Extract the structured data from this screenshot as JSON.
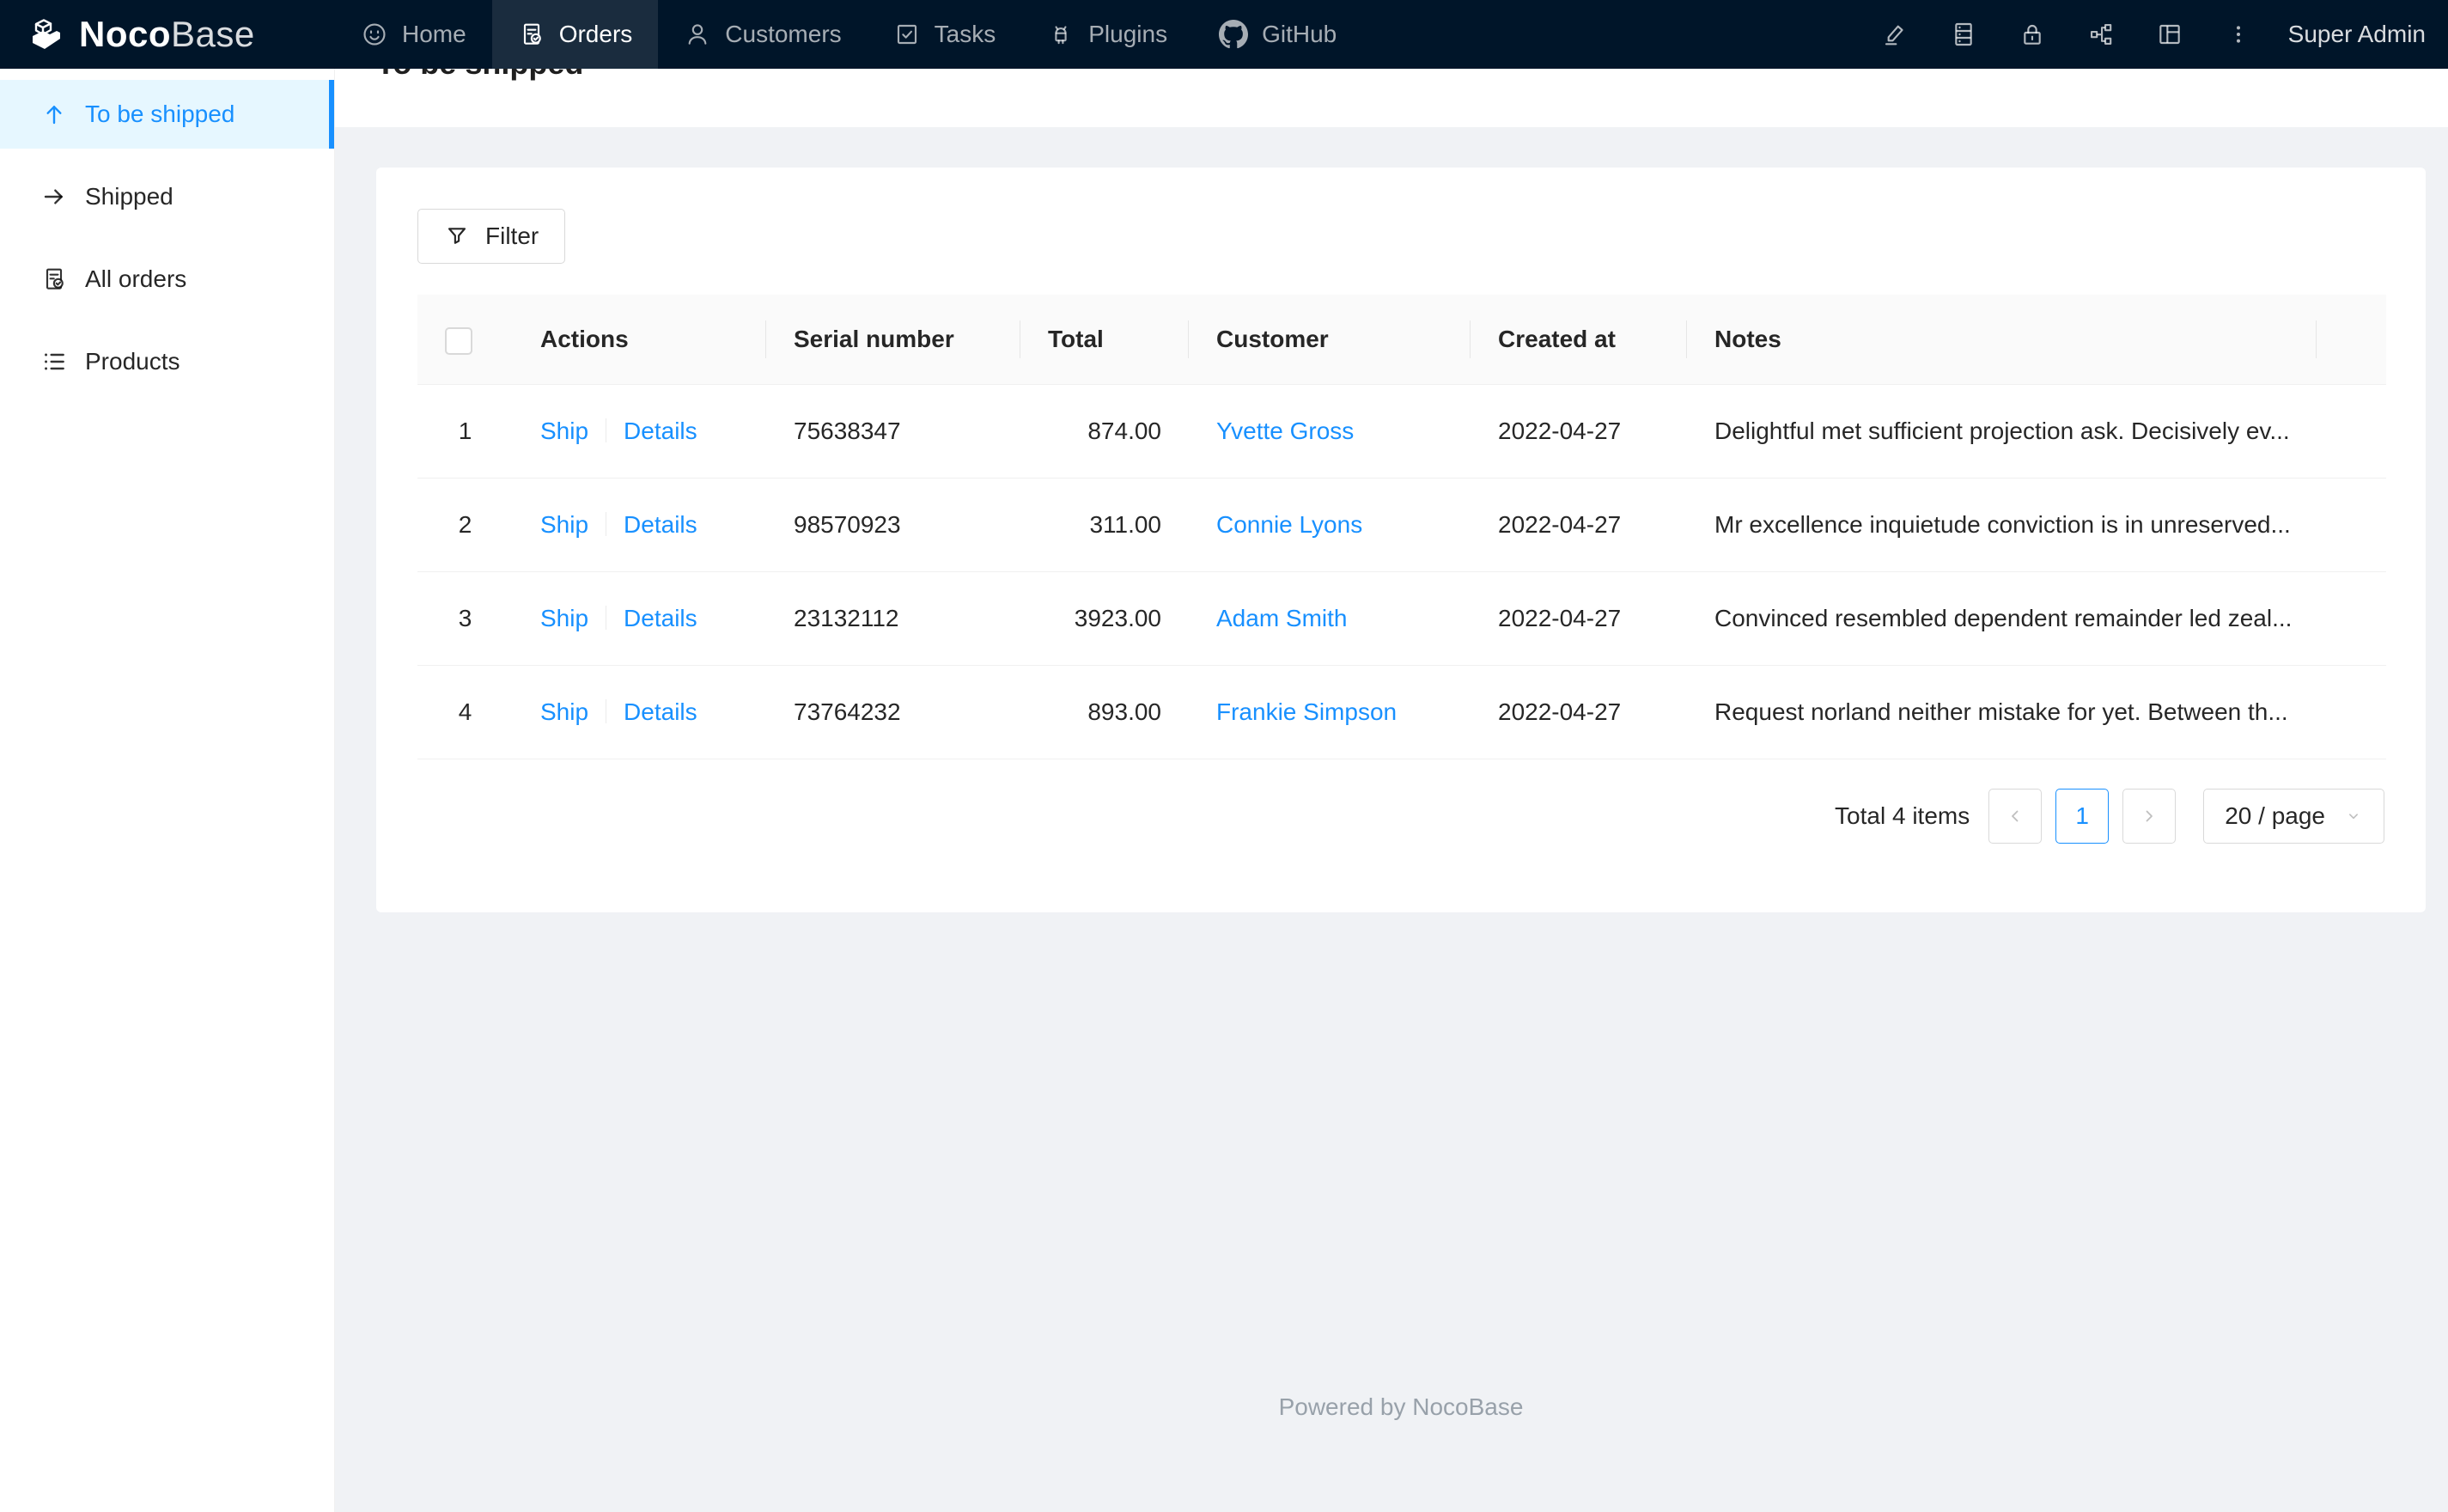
{
  "app": {
    "brand_bold": "Noco",
    "brand_light": "Base",
    "user": "Super Admin"
  },
  "nav": {
    "items": [
      {
        "label": "Home"
      },
      {
        "label": "Orders"
      },
      {
        "label": "Customers"
      },
      {
        "label": "Tasks"
      },
      {
        "label": "Plugins"
      },
      {
        "label": "GitHub"
      }
    ]
  },
  "sidebar": {
    "items": [
      {
        "label": "To be shipped"
      },
      {
        "label": "Shipped"
      },
      {
        "label": "All orders"
      },
      {
        "label": "Products"
      }
    ]
  },
  "page": {
    "title": "To be shipped"
  },
  "toolbar": {
    "filter_label": "Filter"
  },
  "table": {
    "columns": {
      "actions": "Actions",
      "serial": "Serial number",
      "total": "Total",
      "customer": "Customer",
      "created": "Created at",
      "notes": "Notes"
    },
    "action_labels": {
      "ship": "Ship",
      "details": "Details"
    },
    "rows": [
      {
        "index": "1",
        "serial": "75638347",
        "total": "874.00",
        "customer": "Yvette Gross",
        "created": "2022-04-27",
        "notes": "Delightful met sufficient projection ask. Decisively ev..."
      },
      {
        "index": "2",
        "serial": "98570923",
        "total": "311.00",
        "customer": "Connie Lyons",
        "created": "2022-04-27",
        "notes": "Mr excellence inquietude conviction is in unreserved..."
      },
      {
        "index": "3",
        "serial": "23132112",
        "total": "3923.00",
        "customer": "Adam Smith",
        "created": "2022-04-27",
        "notes": "Convinced resembled dependent remainder led zeal..."
      },
      {
        "index": "4",
        "serial": "73764232",
        "total": "893.00",
        "customer": "Frankie Simpson",
        "created": "2022-04-27",
        "notes": "Request norland neither mistake for yet. Between th..."
      }
    ]
  },
  "pagination": {
    "total_text": "Total 4 items",
    "current_page": "1",
    "page_size": "20 / page"
  },
  "footer": {
    "text": "Powered by NocoBase"
  },
  "colors": {
    "accent": "#1890ff",
    "nav_bg": "#001529",
    "active_item_bg": "#e6f7ff",
    "page_bg": "#f0f2f5",
    "card_bg": "#ffffff",
    "table_header_bg": "#fafafa",
    "row_border": "#f0f0f0",
    "control_border": "#d9d9d9"
  }
}
